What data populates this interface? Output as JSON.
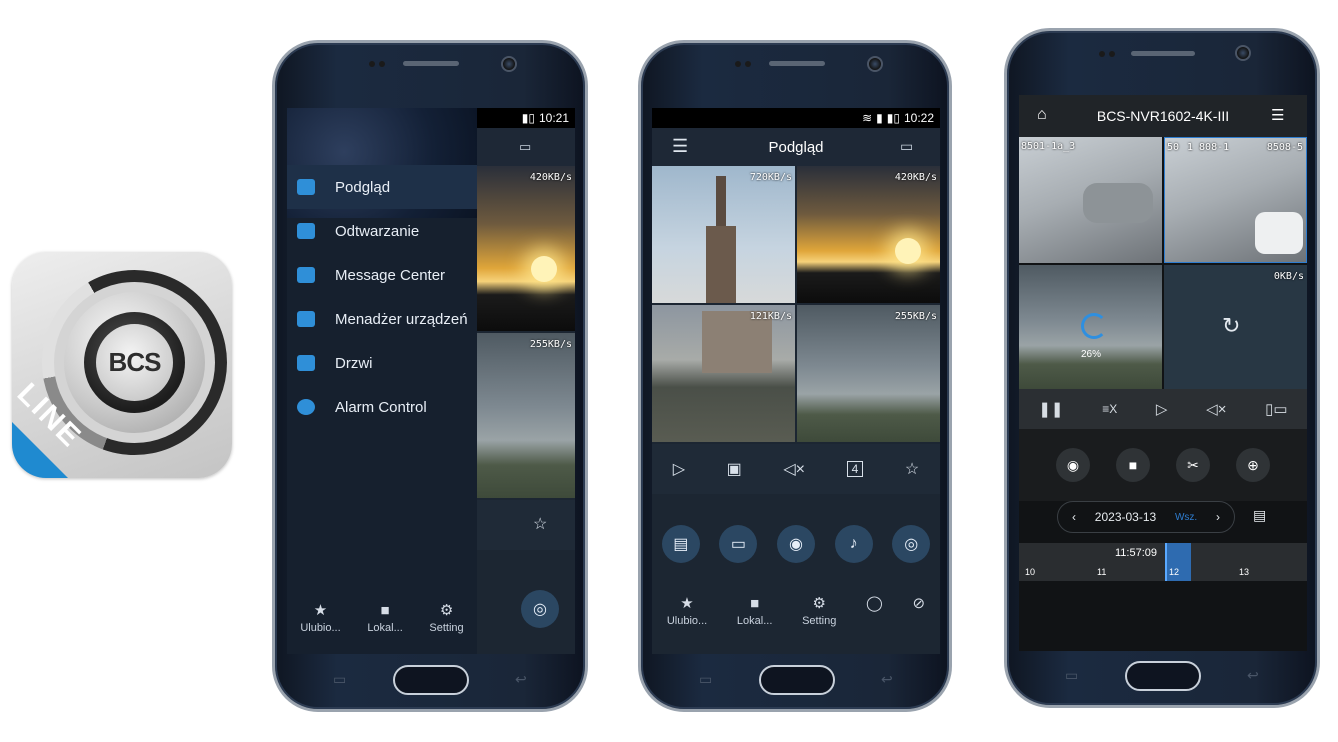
{
  "app_icon": {
    "brand": "BCS",
    "badge": "LINE",
    "accent": "#1f8ad0"
  },
  "phone1": {
    "status_time": "10:21",
    "menu": [
      {
        "label": "Podgląd",
        "icon": "camera-icon"
      },
      {
        "label": "Odtwarzanie",
        "icon": "film-icon"
      },
      {
        "label": "Message Center",
        "icon": "envelope-icon"
      },
      {
        "label": "Menadżer urządzeń",
        "icon": "device-manager-icon"
      },
      {
        "label": "Drzwi",
        "icon": "door-icon"
      },
      {
        "label": "Alarm Control",
        "icon": "alarm-icon"
      }
    ],
    "tile_rates": [
      "420KB/s",
      "255KB/s"
    ],
    "tabs": [
      {
        "label": "Ulubio...",
        "icon": "star-icon"
      },
      {
        "label": "Lokal...",
        "icon": "folder-icon"
      },
      {
        "label": "Setting",
        "icon": "gear-icon"
      }
    ]
  },
  "phone2": {
    "status_time": "10:22",
    "title": "Podgląd",
    "tile_rates": [
      "720KB/s",
      "420KB/s",
      "121KB/s",
      "255KB/s"
    ],
    "toolbar": {
      "split_label": "4"
    },
    "tabs": [
      {
        "label": "Ulubio...",
        "icon": "star-icon"
      },
      {
        "label": "Lokal...",
        "icon": "folder-icon"
      },
      {
        "label": "Setting",
        "icon": "gear-icon"
      }
    ]
  },
  "phone3": {
    "title": "BCS-NVR1602-4K-III",
    "tile_labels": [
      "8501-1a_3",
      "50",
      "1 808-1",
      "8508-5"
    ],
    "tile_rates": [
      "0KB/s"
    ],
    "progress_label": "26%",
    "toolbar": {
      "speed_label": "≡X"
    },
    "date": "2023-03-13",
    "date_mode": "Wsz.",
    "timeline_time": "11:57:09",
    "timeline_ticks": [
      "10",
      "11",
      "12",
      "13"
    ]
  }
}
